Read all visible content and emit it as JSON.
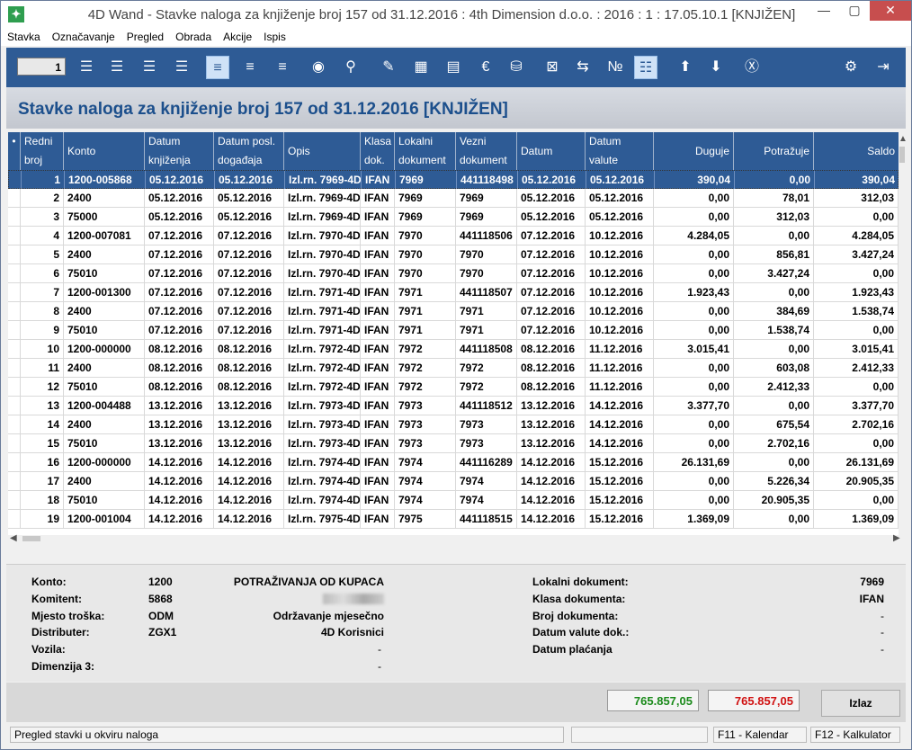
{
  "window": {
    "title": "4D Wand - Stavke naloga za knjiženje broj 157 od 31.12.2016 : 4th Dimension d.o.o. : 2016 : 1 : 17.05.10.1 [KNJIŽEN]",
    "min_label": "—",
    "max_label": "▢",
    "close_label": "✕"
  },
  "menu": [
    "Stavka",
    "Označavanje",
    "Pregled",
    "Obrada",
    "Akcije",
    "Ispis"
  ],
  "toolbar": {
    "counter_value": "1"
  },
  "heading": "Stavke naloga za knjiženje broj 157 od 31.12.2016 [KNJIŽEN]",
  "grid": {
    "marker": "•",
    "columns": [
      {
        "l1": "Redni",
        "l2": "broj"
      },
      {
        "l1": "Konto",
        "l2": ""
      },
      {
        "l1": "Datum",
        "l2": "knjiženja"
      },
      {
        "l1": "Datum posl.",
        "l2": "događaja"
      },
      {
        "l1": "Opis",
        "l2": ""
      },
      {
        "l1": "Klasa",
        "l2": "dok."
      },
      {
        "l1": "Lokalni",
        "l2": "dokument"
      },
      {
        "l1": "Vezni",
        "l2": "dokument"
      },
      {
        "l1": "Datum",
        "l2": ""
      },
      {
        "l1": "Datum",
        "l2": "valute"
      },
      {
        "l1": "Duguje",
        "l2": ""
      },
      {
        "l1": "Potražuje",
        "l2": ""
      },
      {
        "l1": "Saldo",
        "l2": ""
      }
    ],
    "rows": [
      [
        "1",
        "1200-005868",
        "05.12.2016",
        "05.12.2016",
        "Izl.rn. 7969-4D",
        "IFAN",
        "7969",
        "441118498",
        "05.12.2016",
        "05.12.2016",
        "390,04",
        "0,00",
        "390,04"
      ],
      [
        "2",
        "2400",
        "05.12.2016",
        "05.12.2016",
        "Izl.rn. 7969-4D",
        "IFAN",
        "7969",
        "7969",
        "05.12.2016",
        "05.12.2016",
        "0,00",
        "78,01",
        "312,03"
      ],
      [
        "3",
        "75000",
        "05.12.2016",
        "05.12.2016",
        "Izl.rn. 7969-4D",
        "IFAN",
        "7969",
        "7969",
        "05.12.2016",
        "05.12.2016",
        "0,00",
        "312,03",
        "0,00"
      ],
      [
        "4",
        "1200-007081",
        "07.12.2016",
        "07.12.2016",
        "Izl.rn. 7970-4D",
        "IFAN",
        "7970",
        "441118506",
        "07.12.2016",
        "10.12.2016",
        "4.284,05",
        "0,00",
        "4.284,05"
      ],
      [
        "5",
        "2400",
        "07.12.2016",
        "07.12.2016",
        "Izl.rn. 7970-4D",
        "IFAN",
        "7970",
        "7970",
        "07.12.2016",
        "10.12.2016",
        "0,00",
        "856,81",
        "3.427,24"
      ],
      [
        "6",
        "75010",
        "07.12.2016",
        "07.12.2016",
        "Izl.rn. 7970-4D",
        "IFAN",
        "7970",
        "7970",
        "07.12.2016",
        "10.12.2016",
        "0,00",
        "3.427,24",
        "0,00"
      ],
      [
        "7",
        "1200-001300",
        "07.12.2016",
        "07.12.2016",
        "Izl.rn. 7971-4D",
        "IFAN",
        "7971",
        "441118507",
        "07.12.2016",
        "10.12.2016",
        "1.923,43",
        "0,00",
        "1.923,43"
      ],
      [
        "8",
        "2400",
        "07.12.2016",
        "07.12.2016",
        "Izl.rn. 7971-4D",
        "IFAN",
        "7971",
        "7971",
        "07.12.2016",
        "10.12.2016",
        "0,00",
        "384,69",
        "1.538,74"
      ],
      [
        "9",
        "75010",
        "07.12.2016",
        "07.12.2016",
        "Izl.rn. 7971-4D",
        "IFAN",
        "7971",
        "7971",
        "07.12.2016",
        "10.12.2016",
        "0,00",
        "1.538,74",
        "0,00"
      ],
      [
        "10",
        "1200-000000",
        "08.12.2016",
        "08.12.2016",
        "Izl.rn. 7972-4D",
        "IFAN",
        "7972",
        "441118508",
        "08.12.2016",
        "11.12.2016",
        "3.015,41",
        "0,00",
        "3.015,41"
      ],
      [
        "11",
        "2400",
        "08.12.2016",
        "08.12.2016",
        "Izl.rn. 7972-4D",
        "IFAN",
        "7972",
        "7972",
        "08.12.2016",
        "11.12.2016",
        "0,00",
        "603,08",
        "2.412,33"
      ],
      [
        "12",
        "75010",
        "08.12.2016",
        "08.12.2016",
        "Izl.rn. 7972-4D",
        "IFAN",
        "7972",
        "7972",
        "08.12.2016",
        "11.12.2016",
        "0,00",
        "2.412,33",
        "0,00"
      ],
      [
        "13",
        "1200-004488",
        "13.12.2016",
        "13.12.2016",
        "Izl.rn. 7973-4D",
        "IFAN",
        "7973",
        "441118512",
        "13.12.2016",
        "14.12.2016",
        "3.377,70",
        "0,00",
        "3.377,70"
      ],
      [
        "14",
        "2400",
        "13.12.2016",
        "13.12.2016",
        "Izl.rn. 7973-4D",
        "IFAN",
        "7973",
        "7973",
        "13.12.2016",
        "14.12.2016",
        "0,00",
        "675,54",
        "2.702,16"
      ],
      [
        "15",
        "75010",
        "13.12.2016",
        "13.12.2016",
        "Izl.rn. 7973-4D",
        "IFAN",
        "7973",
        "7973",
        "13.12.2016",
        "14.12.2016",
        "0,00",
        "2.702,16",
        "0,00"
      ],
      [
        "16",
        "1200-000000",
        "14.12.2016",
        "14.12.2016",
        "Izl.rn. 7974-4D",
        "IFAN",
        "7974",
        "441116289",
        "14.12.2016",
        "15.12.2016",
        "26.131,69",
        "0,00",
        "26.131,69"
      ],
      [
        "17",
        "2400",
        "14.12.2016",
        "14.12.2016",
        "Izl.rn. 7974-4D",
        "IFAN",
        "7974",
        "7974",
        "14.12.2016",
        "15.12.2016",
        "0,00",
        "5.226,34",
        "20.905,35"
      ],
      [
        "18",
        "75010",
        "14.12.2016",
        "14.12.2016",
        "Izl.rn. 7974-4D",
        "IFAN",
        "7974",
        "7974",
        "14.12.2016",
        "15.12.2016",
        "0,00",
        "20.905,35",
        "0,00"
      ],
      [
        "19",
        "1200-001004",
        "14.12.2016",
        "14.12.2016",
        "Izl.rn. 7975-4D",
        "IFAN",
        "7975",
        "441118515",
        "14.12.2016",
        "15.12.2016",
        "1.369,09",
        "0,00",
        "1.369,09"
      ]
    ]
  },
  "info": {
    "konto_label": "Konto:",
    "konto_value": "1200",
    "konto_desc": "POTRAŽIVANJA OD KUPACA",
    "komitent_label": "Komitent:",
    "komitent_value": "5868",
    "mjesto_label": "Mjesto troška:",
    "mjesto_value": "ODM",
    "mjesto_desc": "Održavanje mjesečno",
    "distributer_label": "Distributer:",
    "distributer_value": "ZGX1",
    "distributer_desc": "4D Korisnici",
    "vozila_label": "Vozila:",
    "vozila_desc": "-",
    "dimenzija_label": "Dimenzija 3:",
    "dimenzija_desc": "-",
    "lokalni_label": "Lokalni dokument:",
    "lokalni_value": "7969",
    "klasa_label": "Klasa dokumenta:",
    "klasa_value": "IFAN",
    "broj_label": "Broj dokumenta:",
    "broj_value": "-",
    "valuta_label": "Datum valute dok.:",
    "valuta_value": "-",
    "placanje_label": "Datum plaćanja",
    "placanje_value": "-"
  },
  "footer": {
    "total_duguje": "765.857,05",
    "total_potrazuje": "765.857,05",
    "exit_label": "Izlaz",
    "duguje_color": "#1a8a1a",
    "potrazuje_color": "#d01010"
  },
  "status": {
    "text": "Pregled stavki u okviru naloga",
    "f11": "F11 - Kalendar",
    "f12": "F12 - Kalkulator"
  }
}
